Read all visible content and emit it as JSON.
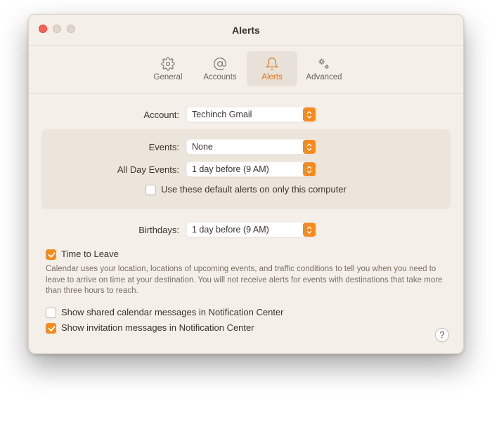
{
  "window": {
    "title": "Alerts"
  },
  "tabs": {
    "general": "General",
    "accounts": "Accounts",
    "alerts": "Alerts",
    "advanced": "Advanced"
  },
  "labels": {
    "account": "Account:",
    "events": "Events:",
    "allDay": "All Day Events:",
    "birthdays": "Birthdays:"
  },
  "selects": {
    "account": "Techinch Gmail",
    "events": "None",
    "allDay": "1 day before (9 AM)",
    "birthdays": "1 day before (9 AM)"
  },
  "checks": {
    "onlyThisComputer": "Use these default alerts on only this computer",
    "timeToLeave": "Time to Leave",
    "sharedCal": "Show shared calendar messages in Notification Center",
    "invitation": "Show invitation messages in Notification Center"
  },
  "desc": "Calendar uses your location, locations of upcoming events, and traffic conditions to tell you when you need to leave to arrive on time at your destination. You will not receive alerts for events with destinations that take more than three hours to reach.",
  "help": "?"
}
